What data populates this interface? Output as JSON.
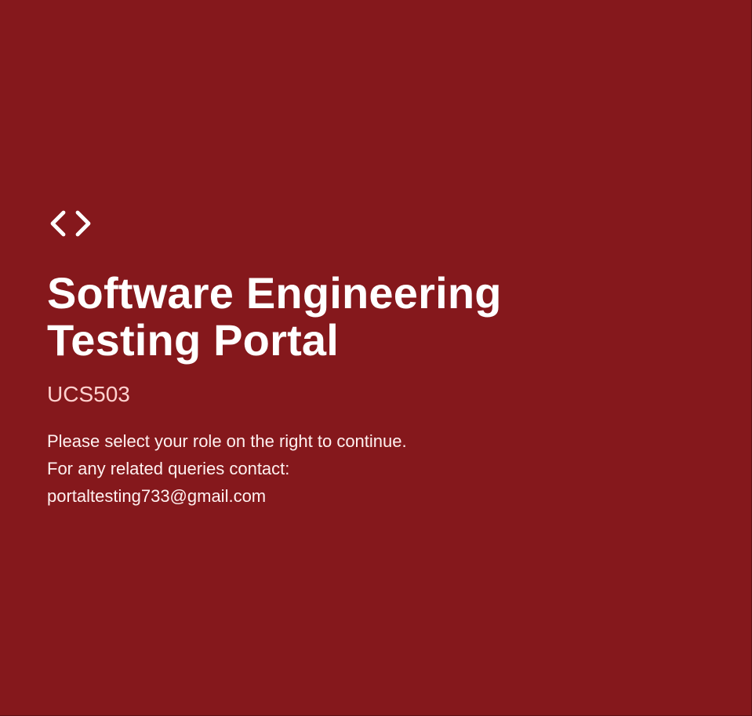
{
  "branding": {
    "icon": "code-icon",
    "title_line_1": "Software Engineering",
    "title_line_2": "Testing Portal",
    "course_code": "UCS503"
  },
  "instructions": {
    "line_1": "Please select your role on the right to continue.",
    "line_2": "For any related queries contact:",
    "email": "portaltesting733@gmail.com"
  },
  "colors": {
    "background": "#85181c",
    "title": "#ffffff",
    "subtitle": "#ffd2cf",
    "text": "#fff1f0"
  }
}
